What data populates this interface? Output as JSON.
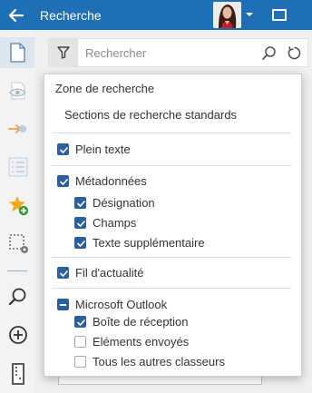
{
  "header": {
    "title": "Recherche"
  },
  "search": {
    "placeholder": "Rechercher",
    "value": ""
  },
  "panel": {
    "title": "Zone de recherche",
    "subtitle": "Sections de recherche standards",
    "options": [
      {
        "label": "Plein texte",
        "state": "checked"
      },
      {
        "label": "Métadonnées",
        "state": "checked"
      },
      {
        "label": "Désignation",
        "state": "checked"
      },
      {
        "label": "Champs",
        "state": "checked"
      },
      {
        "label": "Texte supplémentaire",
        "state": "checked"
      },
      {
        "label": "Fil d'actualité",
        "state": "checked"
      },
      {
        "label": "Microsoft Outlook",
        "state": "partial"
      },
      {
        "label": "Boîte de réception",
        "state": "checked"
      },
      {
        "label": "Eléments envoyés",
        "state": "unchecked"
      },
      {
        "label": "Tous les autres classeurs",
        "state": "unchecked"
      }
    ]
  },
  "rail": {
    "items": [
      "document-icon",
      "eye-icon",
      "workflow-icon",
      "list-icon",
      "favorite-add-icon",
      "selection-settings-icon",
      "search-icon",
      "add-icon",
      "server-icon"
    ]
  },
  "colors": {
    "header": "#1f6fb5",
    "accent": "#2a5fa0",
    "rail": "#f3f3f3"
  }
}
